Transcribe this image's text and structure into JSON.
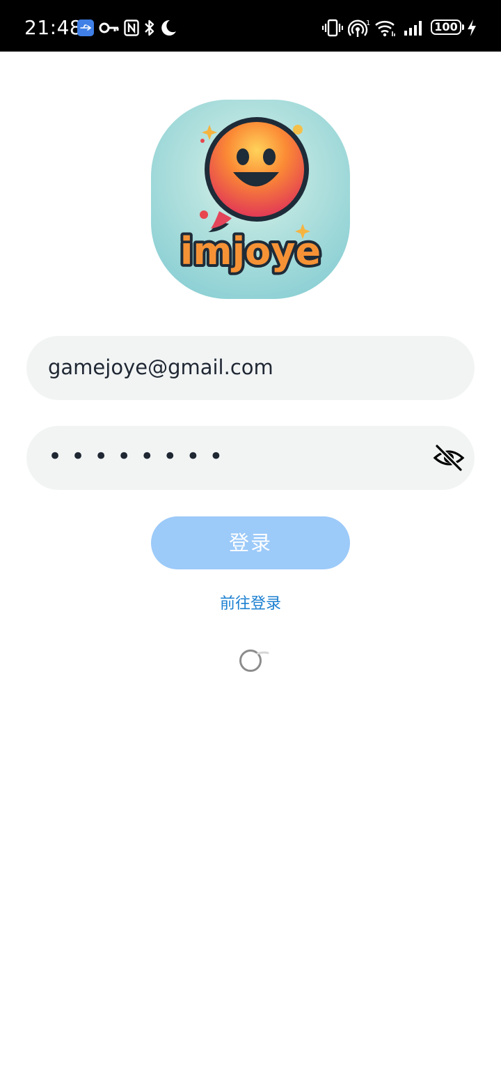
{
  "status_bar": {
    "time": "21:48",
    "left_icons": [
      "usb-debug-icon",
      "key-icon",
      "nfc-icon",
      "bluetooth-icon",
      "do-not-disturb-moon-icon"
    ],
    "right_icons": [
      "vibrate-icon",
      "hotspot-icon",
      "wifi-icon",
      "signal-icon",
      "battery-icon",
      "charging-bolt-icon"
    ],
    "battery": "100"
  },
  "logo": {
    "wordmark": "imjoye",
    "icon": "smiling-chat-bubble-logo"
  },
  "form": {
    "email_value": "gamejoye@gmail.com",
    "password_mask": "••••••••",
    "visibility_icon": "eye-off-icon"
  },
  "actions": {
    "login_label": "登录",
    "goto_login_label": "前往登录"
  },
  "colors": {
    "button_disabled": "#9ccaf9",
    "link": "#1a7fd0",
    "field_bg": "#f2f4f4",
    "logo_bg": "#8fd1d5"
  }
}
